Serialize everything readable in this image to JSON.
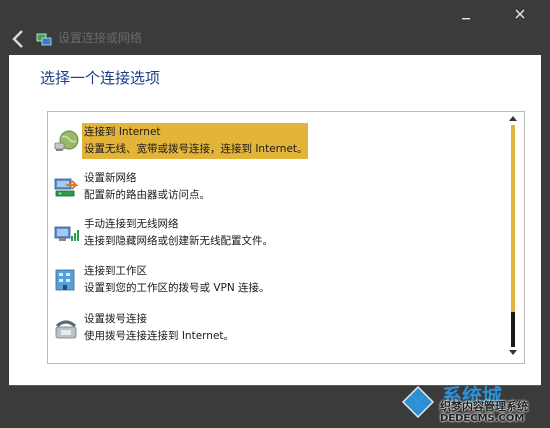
{
  "window": {
    "title": "设置连接或网络"
  },
  "heading": "选择一个连接选项",
  "options": [
    {
      "title": "连接到 Internet",
      "description": "设置无线、宽带或拨号连接，连接到 Internet。",
      "icon": "globe-icon",
      "selected": true
    },
    {
      "title": "设置新网络",
      "description": "配置新的路由器或访问点。",
      "icon": "router-icon",
      "selected": false
    },
    {
      "title": "手动连接到无线网络",
      "description": "连接到隐藏网络或创建新无线配置文件。",
      "icon": "wireless-network-icon",
      "selected": false
    },
    {
      "title": "连接到工作区",
      "description": "设置到您的工作区的拨号或 VPN 连接。",
      "icon": "workplace-icon",
      "selected": false
    },
    {
      "title": "设置拨号连接",
      "description": "使用拨号连接连接到 Internet。",
      "icon": "telephone-icon",
      "selected": false
    }
  ],
  "watermark": {
    "brand": "系统城",
    "subtitle": "织梦内容管理系统",
    "url": "DEDECMS.COM"
  },
  "colors": {
    "selection": "#e2b43a",
    "heading": "#1c3e86",
    "frame": "#3b3b3b"
  }
}
